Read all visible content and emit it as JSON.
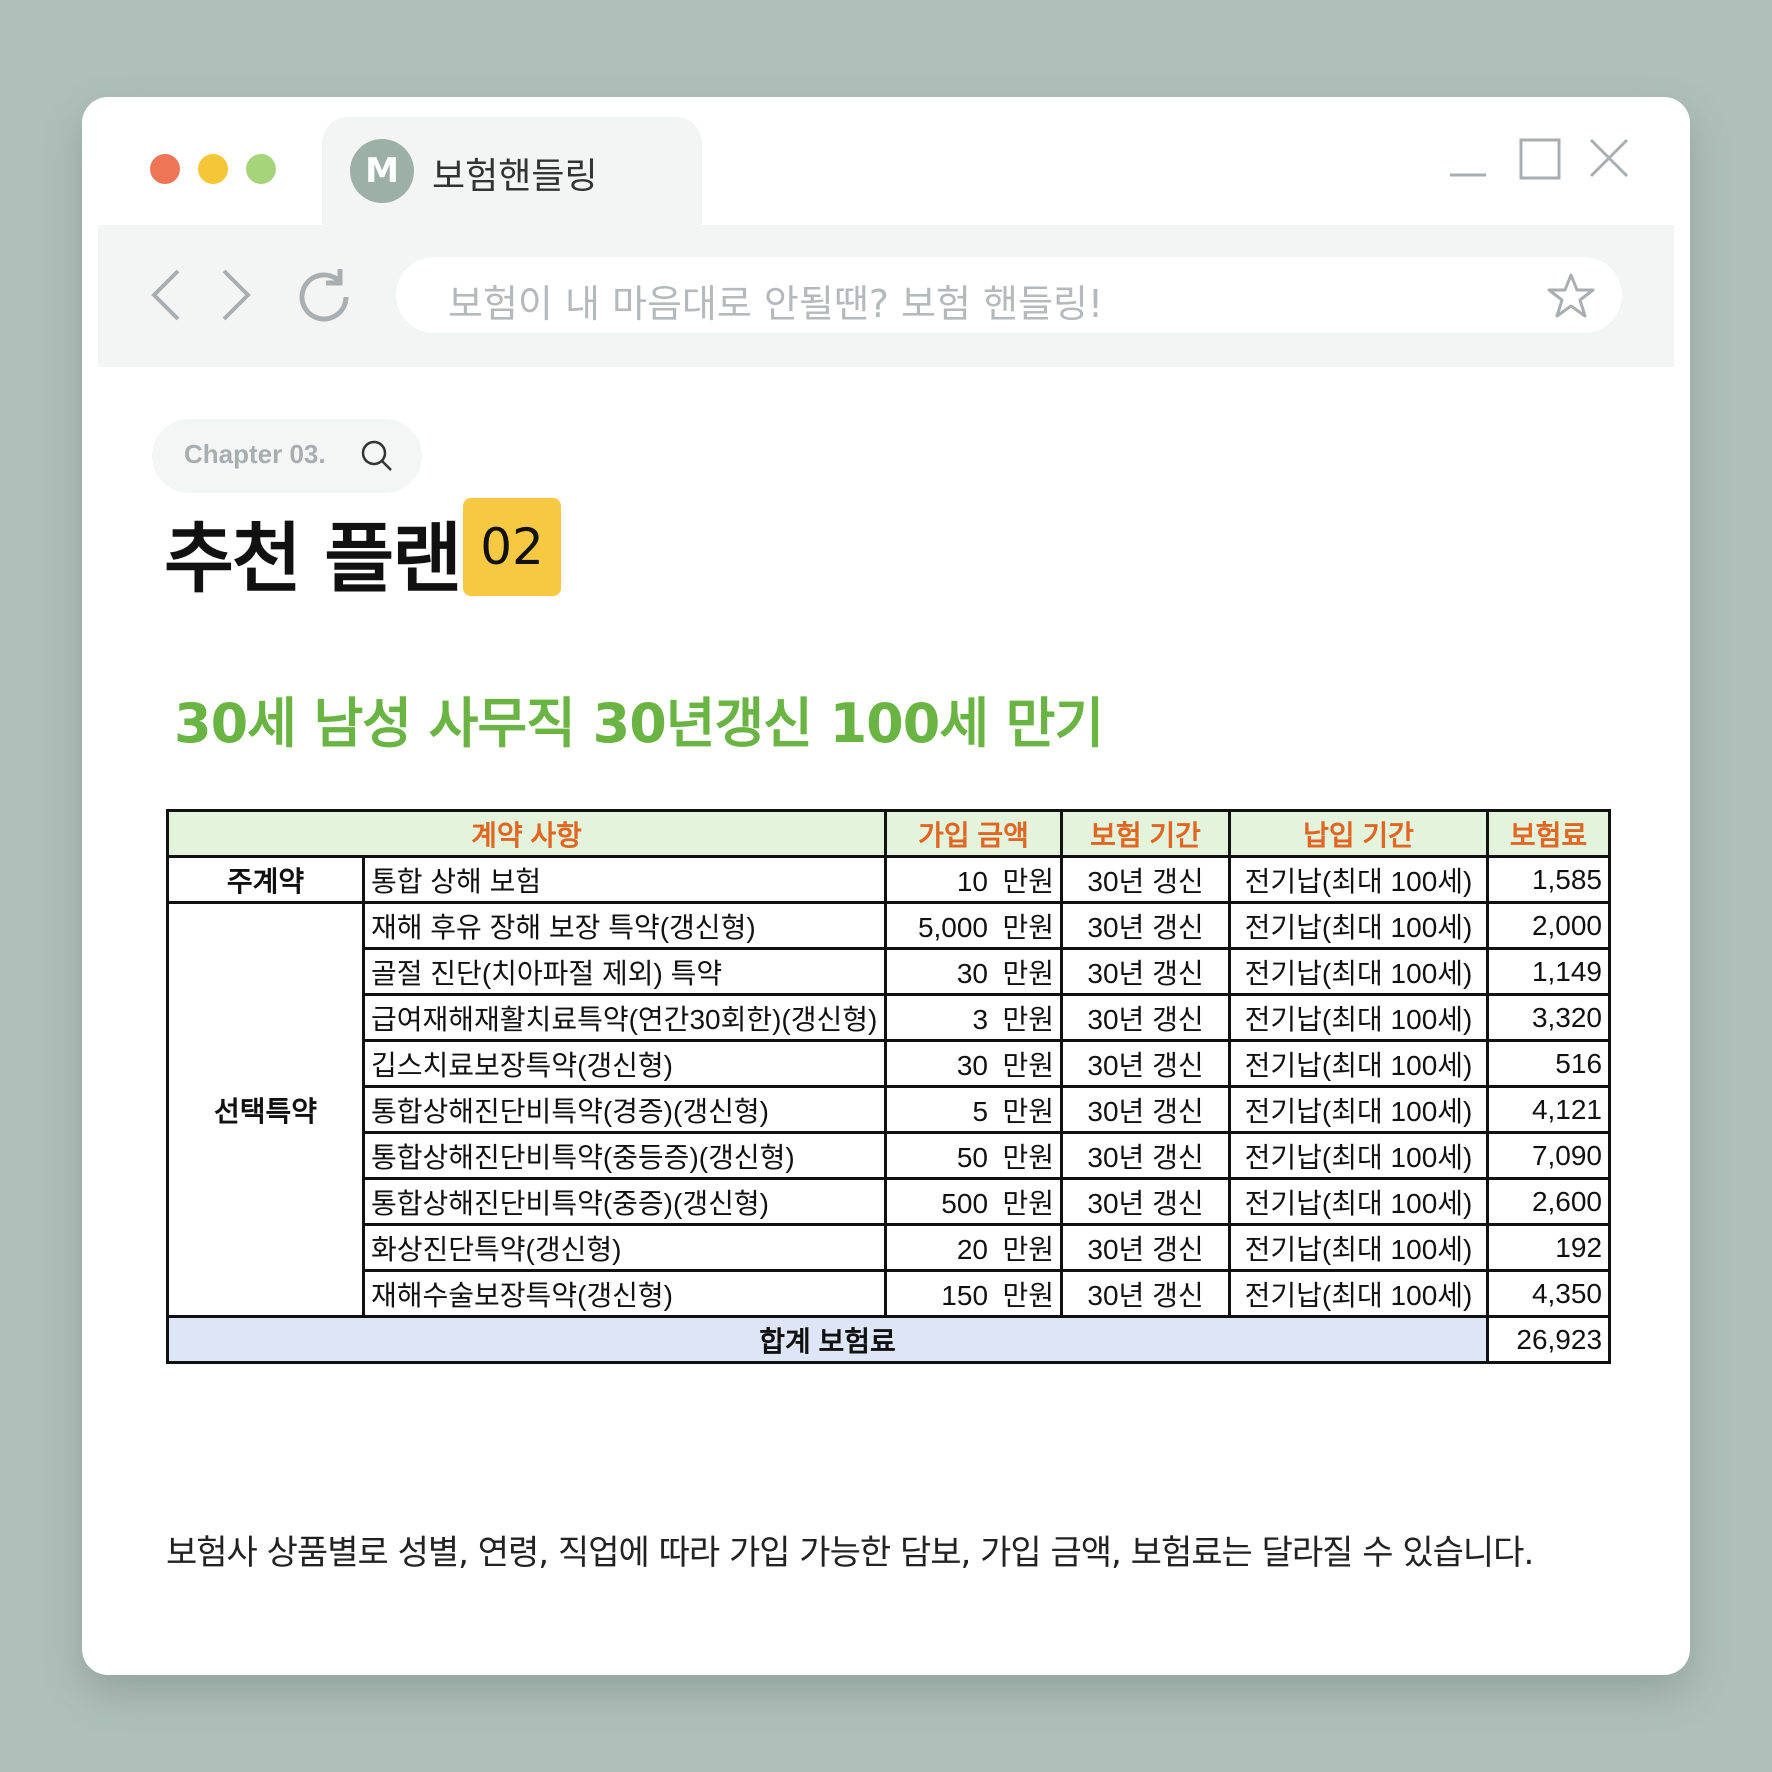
{
  "window": {
    "tab_avatar_letter": "M",
    "tab_title": "보험핸들링",
    "address_bar_text": "보험이 내 마음대로 안될땐? 보험 핸들링!"
  },
  "content": {
    "chapter": "Chapter 03.",
    "heading": "추천 플랜",
    "badge": "02",
    "subtitle": "30세 남성 사무직 30년갱신 100세 만기",
    "footnote": "보험사 상품별로 성별, 연령, 직업에 따라 가입 가능한 담보, 가입 금액, 보험료는 달라질 수 있습니다."
  },
  "table": {
    "headers": [
      "계약 사항",
      "가입 금액",
      "보험 기간",
      "납입 기간",
      "보험료"
    ],
    "categories": {
      "main": "주계약",
      "rider": "선택특약"
    },
    "rows": [
      {
        "name": "통합 상해 보험",
        "amount": "10",
        "unit": "만원",
        "term": "30년 갱신",
        "pay": "전기납(최대 100세)",
        "premium": "1,585"
      },
      {
        "name": "재해 후유 장해 보장 특약(갱신형)",
        "amount": "5,000",
        "unit": "만원",
        "term": "30년 갱신",
        "pay": "전기납(최대 100세)",
        "premium": "2,000"
      },
      {
        "name": "골절 진단(치아파절 제외) 특약",
        "amount": "30",
        "unit": "만원",
        "term": "30년 갱신",
        "pay": "전기납(최대 100세)",
        "premium": "1,149"
      },
      {
        "name": "급여재해재활치료특약(연간30회한)(갱신형)",
        "amount": "3",
        "unit": "만원",
        "term": "30년 갱신",
        "pay": "전기납(최대 100세)",
        "premium": "3,320"
      },
      {
        "name": "깁스치료보장특약(갱신형)",
        "amount": "30",
        "unit": "만원",
        "term": "30년 갱신",
        "pay": "전기납(최대 100세)",
        "premium": "516"
      },
      {
        "name": "통합상해진단비특약(경증)(갱신형)",
        "amount": "5",
        "unit": "만원",
        "term": "30년 갱신",
        "pay": "전기납(최대 100세)",
        "premium": "4,121"
      },
      {
        "name": "통합상해진단비특약(중등증)(갱신형)",
        "amount": "50",
        "unit": "만원",
        "term": "30년 갱신",
        "pay": "전기납(최대 100세)",
        "premium": "7,090"
      },
      {
        "name": "통합상해진단비특약(중증)(갱신형)",
        "amount": "500",
        "unit": "만원",
        "term": "30년 갱신",
        "pay": "전기납(최대 100세)",
        "premium": "2,600"
      },
      {
        "name": "화상진단특약(갱신형)",
        "amount": "20",
        "unit": "만원",
        "term": "30년 갱신",
        "pay": "전기납(최대 100세)",
        "premium": "192"
      },
      {
        "name": "재해수술보장특약(갱신형)",
        "amount": "150",
        "unit": "만원",
        "term": "30년 갱신",
        "pay": "전기납(최대 100세)",
        "premium": "4,350"
      }
    ],
    "total_label": "합계 보험료",
    "total_value": "26,923"
  },
  "icons": [
    "minimize-icon",
    "maximize-icon",
    "close-icon",
    "back-icon",
    "forward-icon",
    "reload-icon",
    "star-icon",
    "search-icon"
  ],
  "colors": {
    "background": "#afc0ba",
    "accent_green": "#69b443",
    "badge_yellow": "#f7c942",
    "header_orange": "#e06622",
    "header_bg": "#e3f3dc",
    "total_bg": "#dde5f7"
  }
}
